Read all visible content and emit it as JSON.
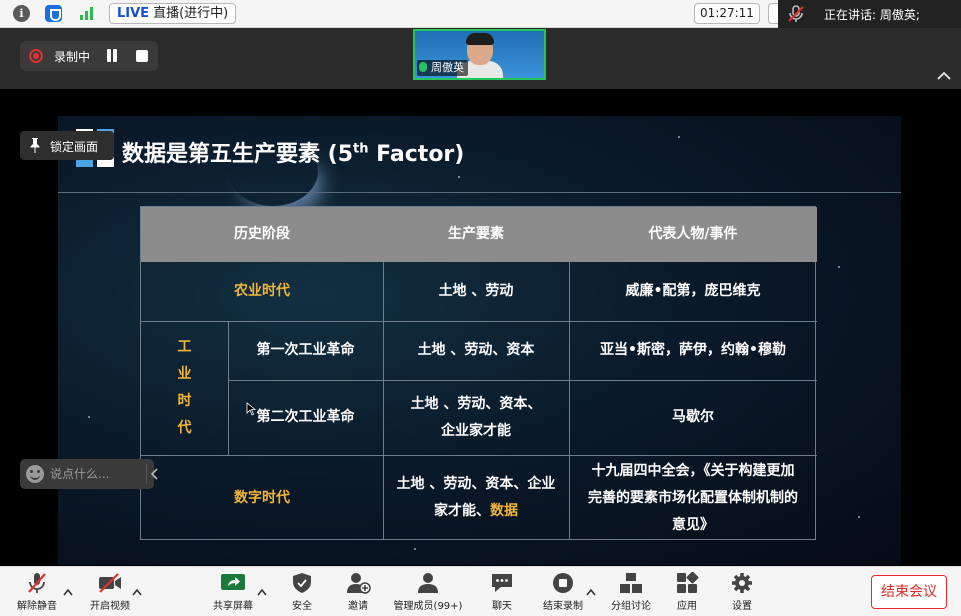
{
  "topbar": {
    "live_badge": "LIVE",
    "live_status": "直播(进行中)",
    "timer": "01:27:11",
    "speaker_text": "正在讲话: 周傲英;"
  },
  "recording": {
    "label": "录制中"
  },
  "video_tile": {
    "name": "周傲英"
  },
  "pin_tag": {
    "label": "锁定画面"
  },
  "chat": {
    "placeholder": "说点什么..."
  },
  "slide": {
    "title": "数据是第五生产要素 (5",
    "title_sup": "th",
    "title_tail": " Factor)",
    "headers": [
      "历史阶段",
      "生产要素",
      "代表人物/事件"
    ],
    "rows": {
      "agri": {
        "stage": "农业时代",
        "factors": "土地 、劳动",
        "event": "威廉•配第，庞巴维克"
      },
      "industrial_label": [
        "工",
        "业",
        "时",
        "代"
      ],
      "ind1": {
        "stage": "第一次工业革命",
        "factors": "土地 、劳动、资本",
        "event": "亚当•斯密，萨伊，约翰•穆勒"
      },
      "ind2": {
        "stage": "第二次工业革命",
        "factors_1": "土地 、劳动、资本、",
        "factors_2": "企业家才能",
        "event": "马歇尔"
      },
      "digital": {
        "stage": "数字时代",
        "factors_1": "土地 、劳动、资本、企业",
        "factors_2": "家才能、",
        "factors_2_highlight": "数据",
        "event_1": "十九届四中全会，《关于构建更加",
        "event_2": "完善的要素市场化配置体制机制的",
        "event_3": "意见》"
      }
    }
  },
  "toolbar": {
    "mute": "解除静音",
    "video": "开启视频",
    "share": "共享屏幕",
    "security": "安全",
    "invite": "邀请",
    "participants": "管理成员(99+)",
    "chat": "聊天",
    "stop_record": "结束录制",
    "breakout": "分组讨论",
    "apps": "应用",
    "settings": "设置",
    "end_meeting": "结束会议"
  },
  "colors": {
    "accent_gold": "#f2b53a",
    "recording_red": "#e0312b",
    "active_green": "#22c55e",
    "end_red": "#e22a2a",
    "live_blue": "#1a4fd6"
  }
}
